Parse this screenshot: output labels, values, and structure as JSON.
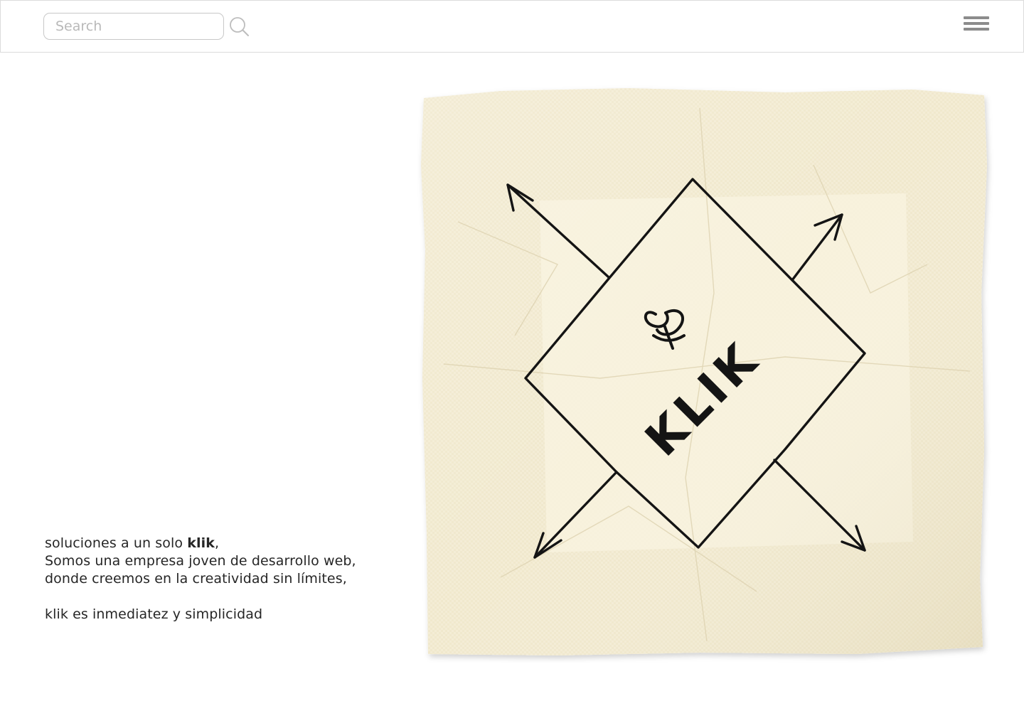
{
  "header": {
    "search_placeholder": "Search",
    "search_icon": "search-icon",
    "menu_icon": "hamburger-menu-icon"
  },
  "intro": {
    "line1_prefix": "soluciones a un solo ",
    "line1_bold": "klik",
    "line1_suffix": ",",
    "line2": "Somos una empresa joven de desarrollo web,",
    "line3": "donde creemos en la creatividad sin límites,",
    "line4": "klik es inmediatez y simplicidad"
  },
  "hero": {
    "napkin_text": "KLIK",
    "colors": {
      "napkin": "#f5eed6",
      "napkin_shadow": "#e6dcbd",
      "ink": "#141414"
    }
  }
}
